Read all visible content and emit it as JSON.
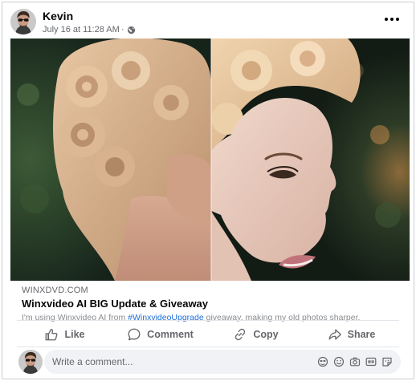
{
  "post": {
    "author": "Kevin",
    "date": "July 16 at 11:28 AM",
    "separator": "·",
    "privacy_icon": "globe-icon",
    "more_icon": "more-options-icon"
  },
  "link_preview": {
    "domain": "WINXDVD.COM",
    "title": "Winxvideo AI BIG Update & Giveaway",
    "description_prefix": "I'm using Winxvideo AI from ",
    "hashtag": "#WinxvideoUpgrade",
    "description_suffix": " giveaway, making my old photos sharper."
  },
  "actions": [
    {
      "label": "Like",
      "icon": "thumbs-up-icon"
    },
    {
      "label": "Comment",
      "icon": "comment-bubble-icon"
    },
    {
      "label": "Copy",
      "icon": "link-icon"
    },
    {
      "label": "Share",
      "icon": "share-arrow-icon"
    }
  ],
  "comment": {
    "placeholder": "Write a comment...",
    "icons": [
      "avatar-sticker-icon",
      "emoji-icon",
      "camera-icon",
      "gif-icon",
      "sticker-icon"
    ]
  },
  "colors": {
    "accent_link": "#216fdb",
    "secondary_text": "#65676b",
    "comment_bg": "#f0f2f5"
  }
}
